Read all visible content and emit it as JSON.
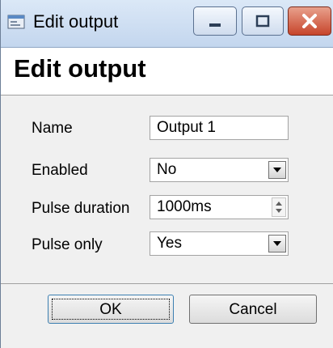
{
  "window": {
    "title": "Edit output",
    "controls": {
      "minimize": "minimize-icon",
      "maximize": "maximize-icon",
      "close": "close-icon"
    }
  },
  "header": {
    "title": "Edit output"
  },
  "form": {
    "name": {
      "label": "Name",
      "value": "Output 1"
    },
    "enabled": {
      "label": "Enabled",
      "value": "No"
    },
    "pulse_duration": {
      "label": "Pulse duration",
      "value": "1000ms"
    },
    "pulse_only": {
      "label": "Pulse only",
      "value": "Yes"
    }
  },
  "buttons": {
    "ok": "OK",
    "cancel": "Cancel"
  },
  "colors": {
    "close_button": "#c7452b",
    "titlebar": "#c3d6ee"
  }
}
